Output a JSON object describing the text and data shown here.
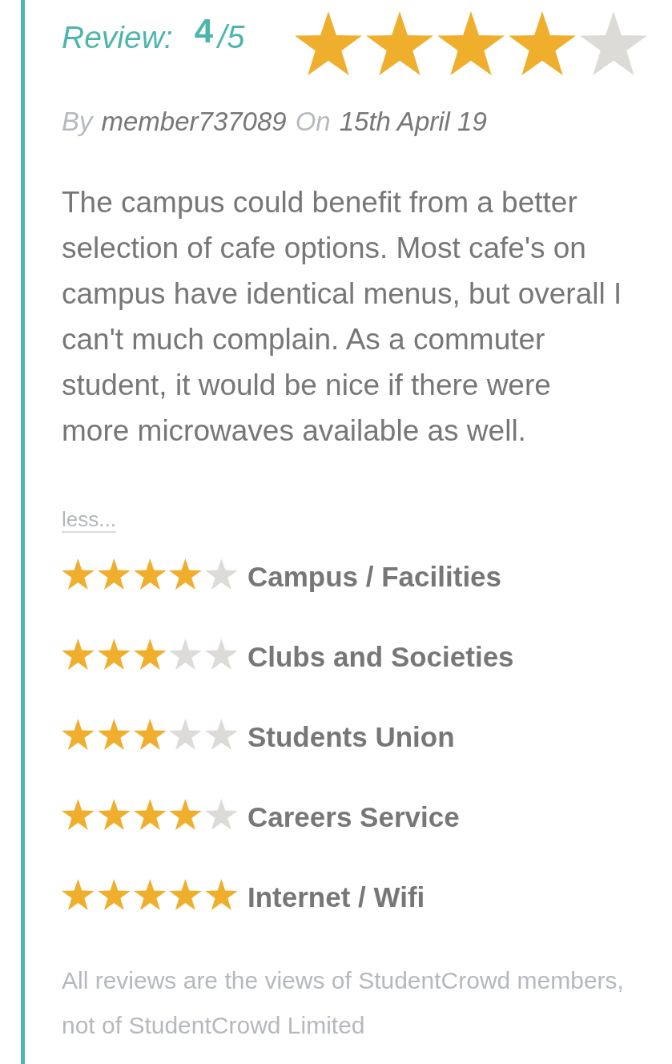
{
  "review": {
    "label": "Review:",
    "score": "4",
    "out_of": "/5",
    "stars": 4
  },
  "byline": {
    "by_label": "By",
    "author": "member737089",
    "on_label": "On",
    "date": "15th April 19"
  },
  "body": "The campus could benefit from a better selection of cafe options. Most cafe's on campus have identical menus, but overall I can't much complain. As a commuter student, it would be nice if there were more microwaves available as well.",
  "less_link": "less...",
  "categories": [
    {
      "name": "Campus / Facilities",
      "stars": 4
    },
    {
      "name": "Clubs and Societies",
      "stars": 3
    },
    {
      "name": "Students Union",
      "stars": 3
    },
    {
      "name": "Careers Service",
      "stars": 4
    },
    {
      "name": "Internet / Wifi",
      "stars": 5
    }
  ],
  "disclaimer": "All reviews are the views of StudentCrowd members, not of StudentCrowd Limited"
}
